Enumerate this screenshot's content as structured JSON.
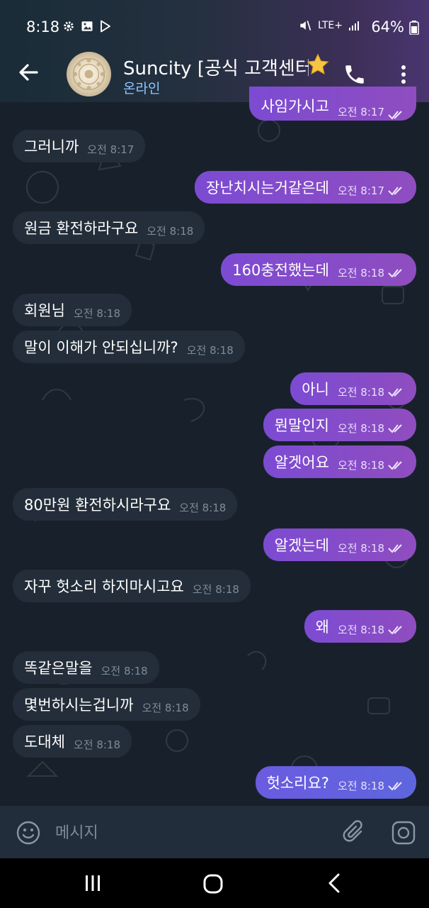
{
  "status_bar": {
    "time": "8:18",
    "network": "LTE+",
    "battery": "64%"
  },
  "header": {
    "title": "Suncity [공식 고객센터",
    "status": "온라인"
  },
  "messages": [
    {
      "side": "out",
      "text": "사임가시고",
      "time": "오전 8:17"
    },
    {
      "side": "in",
      "text": "그러니까",
      "time": "오전 8:17"
    },
    {
      "side": "out",
      "text": "장난치시는거같은데",
      "time": "오전 8:17"
    },
    {
      "side": "in",
      "text": "원금 환전하라구요",
      "time": "오전 8:18"
    },
    {
      "side": "out",
      "text": "160충전했는데",
      "time": "오전 8:18"
    },
    {
      "side": "in",
      "text": "회원님",
      "time": "오전 8:18"
    },
    {
      "side": "in",
      "text": "말이 이해가 안되십니까?",
      "time": "오전 8:18"
    },
    {
      "side": "out",
      "text": "아니",
      "time": "오전 8:18"
    },
    {
      "side": "out",
      "text": "뭔말인지",
      "time": "오전 8:18"
    },
    {
      "side": "out",
      "text": "알겟어요",
      "time": "오전 8:18"
    },
    {
      "side": "in",
      "text": "80만원 환전하시라구요",
      "time": "오전 8:18"
    },
    {
      "side": "out",
      "text": "알겠는데",
      "time": "오전 8:18"
    },
    {
      "side": "in",
      "text": "자꾸 헛소리 하지마시고요",
      "time": "오전 8:18"
    },
    {
      "side": "out",
      "text": "왜",
      "time": "오전 8:18"
    },
    {
      "side": "in",
      "text": "똑같은말을",
      "time": "오전 8:18"
    },
    {
      "side": "in",
      "text": "몇번하시는겁니까",
      "time": "오전 8:18"
    },
    {
      "side": "in",
      "text": "도대체",
      "time": "오전 8:18"
    },
    {
      "side": "out",
      "text": "헛소리요?",
      "time": "오전 8:18"
    }
  ],
  "input": {
    "placeholder": "메시지"
  },
  "colors": {
    "outgoing": "#8a4cd0",
    "incoming": "#232e3a",
    "online": "#8ec5ff"
  }
}
